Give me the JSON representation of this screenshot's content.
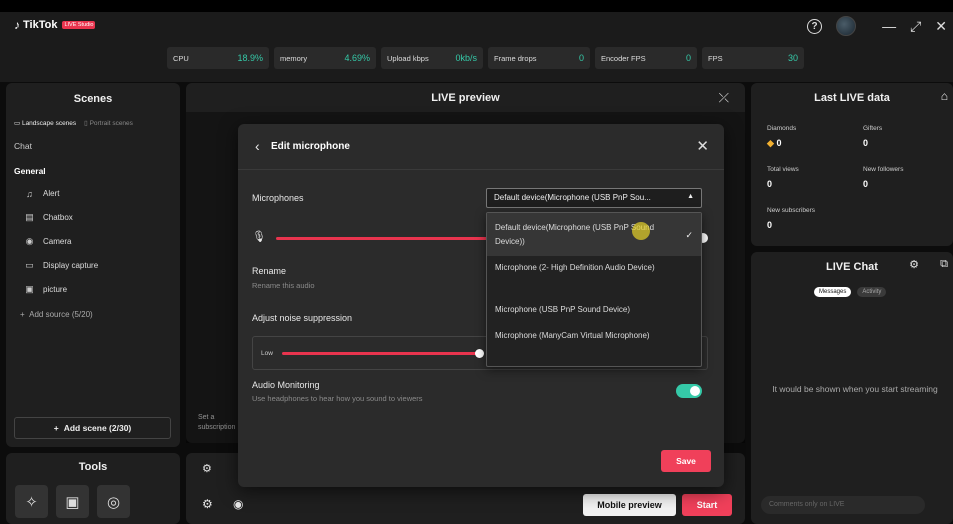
{
  "app": {
    "name": "TikTok",
    "badge": "LIVE Studio"
  },
  "stats": [
    {
      "label": "CPU",
      "value": "18.9%"
    },
    {
      "label": "memory",
      "value": "4.69%"
    },
    {
      "label": "Upload kbps",
      "value": "0kb/s"
    },
    {
      "label": "Frame drops",
      "value": "0"
    },
    {
      "label": "Encoder FPS",
      "value": "0"
    },
    {
      "label": "FPS",
      "value": "30"
    }
  ],
  "scenes": {
    "title": "Scenes",
    "tab_landscape": "Landscape scenes",
    "tab_portrait": "Portrait scenes",
    "chat_label": "Chat",
    "general_label": "General",
    "sources": [
      "Alert",
      "Chatbox",
      "Camera",
      "Display capture",
      "picture"
    ],
    "add_source": "Add source (5/20)",
    "add_scene": "Add scene (2/30)"
  },
  "tools": {
    "title": "Tools"
  },
  "preview": {
    "title": "LIVE preview",
    "mobile_preview": "Mobile preview",
    "start": "Start",
    "set_subscription": "Set a subscription"
  },
  "last_live": {
    "title": "Last LIVE data",
    "diamonds_label": "Diamonds",
    "diamonds_value": "0",
    "gifters_label": "Gifters",
    "gifters_value": "0",
    "total_views_label": "Total views",
    "total_views_value": "0",
    "new_followers_label": "New followers",
    "new_followers_value": "0",
    "new_subscribers_label": "New subscribers",
    "new_subscribers_value": "0"
  },
  "live_chat": {
    "title": "LIVE Chat",
    "tab_messages": "Messages",
    "tab_activity": "Activity",
    "empty": "It would be shown when you start streaming",
    "input_placeholder": "Comments only on LIVE"
  },
  "modal": {
    "title": "Edit microphone",
    "microphones_label": "Microphones",
    "selected_device": "Default device(Microphone (USB PnP Sou...",
    "rename_label": "Rename",
    "rename_sub": "Rename this audio",
    "noise_label": "Adjust noise suppression",
    "noise_low": "Low",
    "monitor_label": "Audio Monitoring",
    "monitor_sub": "Use headphones to hear how you sound to viewers",
    "save": "Save",
    "volume_level": 0.85,
    "noise_level": 0.5,
    "monitoring_on": true
  },
  "dropdown": {
    "options": [
      "Default device(Microphone (USB PnP Sound Device))",
      "Microphone (2- High Definition Audio Device)",
      "Microphone (USB PnP Sound Device)",
      "Microphone (ManyCam Virtual Microphone)"
    ],
    "selected_index": 0
  },
  "colors": {
    "accent": "#f0405a",
    "teal": "#35c9a8"
  }
}
